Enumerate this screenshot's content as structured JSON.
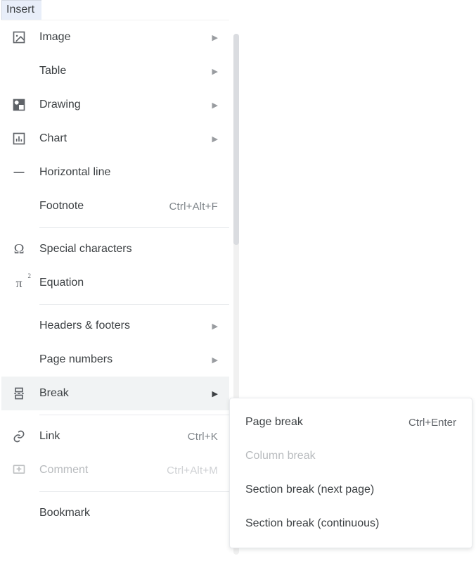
{
  "menu": {
    "title": "Insert",
    "items": {
      "image": {
        "label": "Image"
      },
      "table": {
        "label": "Table"
      },
      "drawing": {
        "label": "Drawing"
      },
      "chart": {
        "label": "Chart"
      },
      "horizontal_line": {
        "label": "Horizontal line"
      },
      "footnote": {
        "label": "Footnote",
        "shortcut": "Ctrl+Alt+F"
      },
      "special_characters": {
        "label": "Special characters"
      },
      "equation": {
        "label": "Equation"
      },
      "headers_footers": {
        "label": "Headers & footers"
      },
      "page_numbers": {
        "label": "Page numbers"
      },
      "break": {
        "label": "Break"
      },
      "link": {
        "label": "Link",
        "shortcut": "Ctrl+K"
      },
      "comment": {
        "label": "Comment",
        "shortcut": "Ctrl+Alt+M"
      },
      "bookmark": {
        "label": "Bookmark"
      }
    }
  },
  "submenu": {
    "page_break": {
      "label": "Page break",
      "shortcut": "Ctrl+Enter"
    },
    "column_break": {
      "label": "Column break"
    },
    "section_next": {
      "label": "Section break (next page)"
    },
    "section_cont": {
      "label": "Section break (continuous)"
    }
  }
}
